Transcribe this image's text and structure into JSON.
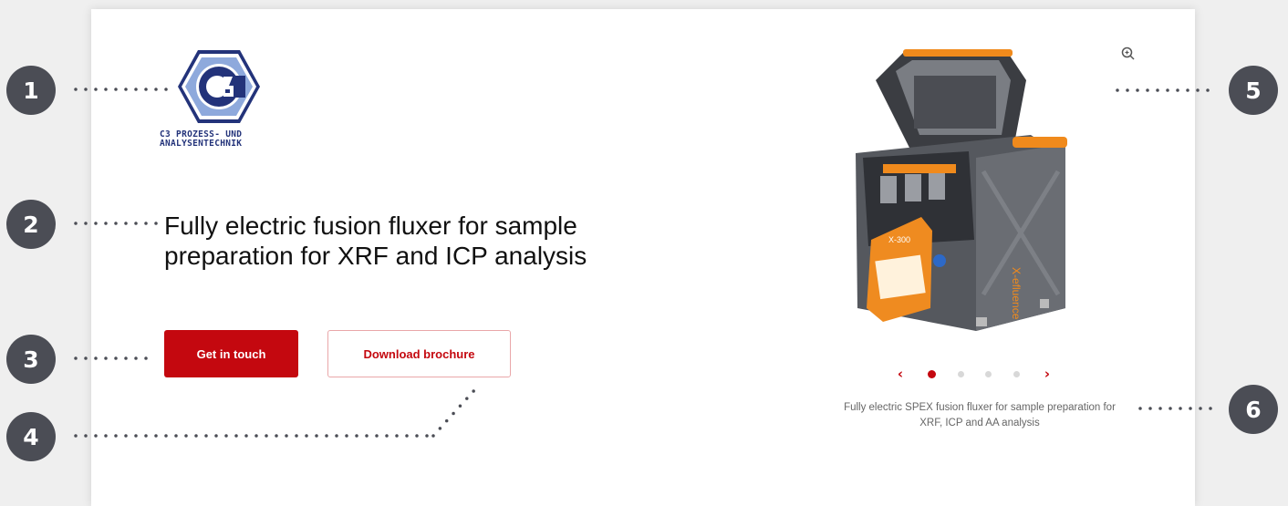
{
  "logo": {
    "line1": "C3 PROZESS- UND",
    "line2": "ANALYSENTECHNIK"
  },
  "headline": {
    "line1": "Fully electric fusion fluxer for sample",
    "line2": "preparation for XRF and ICP analysis"
  },
  "buttons": {
    "primary_label": "Get in touch",
    "secondary_label": "Download brochure"
  },
  "product": {
    "panel_text": "X-300",
    "brand_text": "X-efluence",
    "caption_line1": "Fully electric SPEX fusion fluxer for sample preparation for",
    "caption_line2": "XRF, ICP and AA analysis"
  },
  "carousel": {
    "prev_icon": "‹",
    "next_icon": "›",
    "slides": 5,
    "active": 1
  },
  "annotations": [
    "1",
    "2",
    "3",
    "4",
    "5",
    "6"
  ],
  "colors": {
    "accent": "#c4080f",
    "badge": "#4b4d55",
    "logo": "#23337a",
    "logo_light": "#8ea9dc"
  }
}
